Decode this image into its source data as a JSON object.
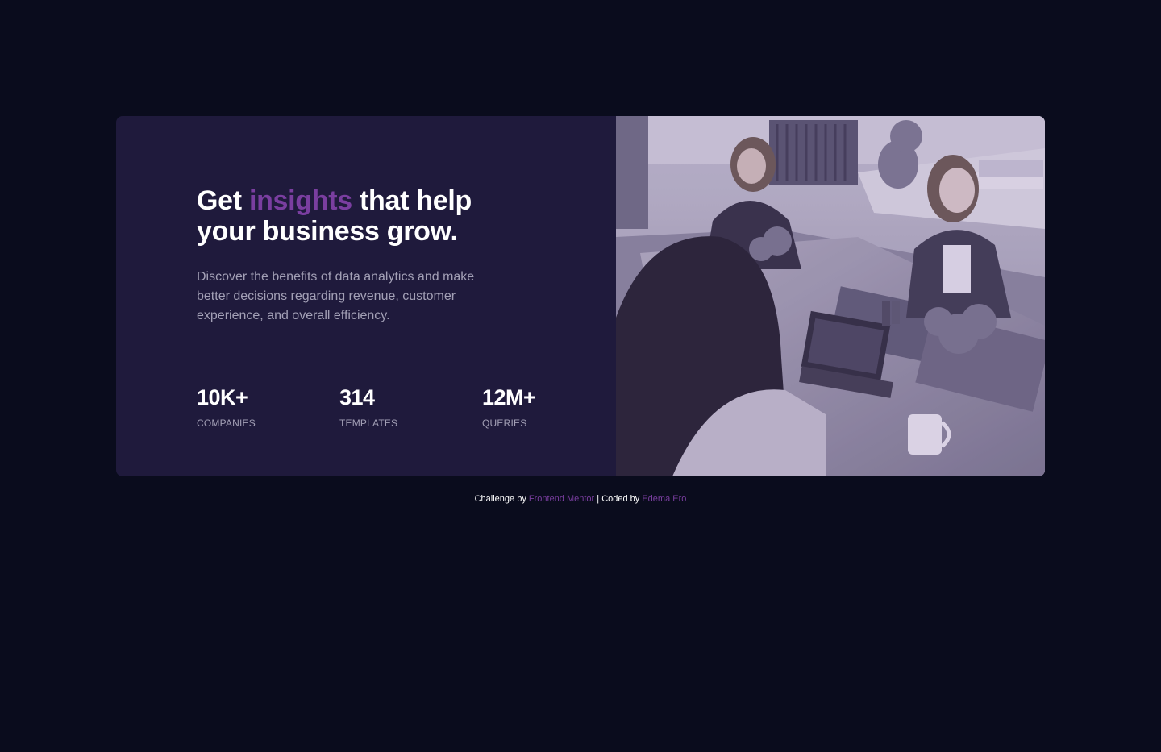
{
  "card": {
    "headline": {
      "before": "Get ",
      "accent": "insights",
      "after": " that help your business grow."
    },
    "description": "Discover the benefits of data analytics and make better decisions regarding revenue, customer experience, and overall efficiency.",
    "stats": [
      {
        "value": "10K+",
        "label": "COMPANIES"
      },
      {
        "value": "314",
        "label": "TEMPLATES"
      },
      {
        "value": "12M+",
        "label": "QUERIES"
      }
    ]
  },
  "footer": {
    "prefix": "Challenge by ",
    "challenge_link": "Frontend Mentor",
    "separator": " | Coded by ",
    "author_link": "Edema Ero"
  },
  "colors": {
    "background": "#0a0c1d",
    "card": "#1f1a3c",
    "accent": "#7a3ea0",
    "muted_text": "#a3a0b6"
  }
}
